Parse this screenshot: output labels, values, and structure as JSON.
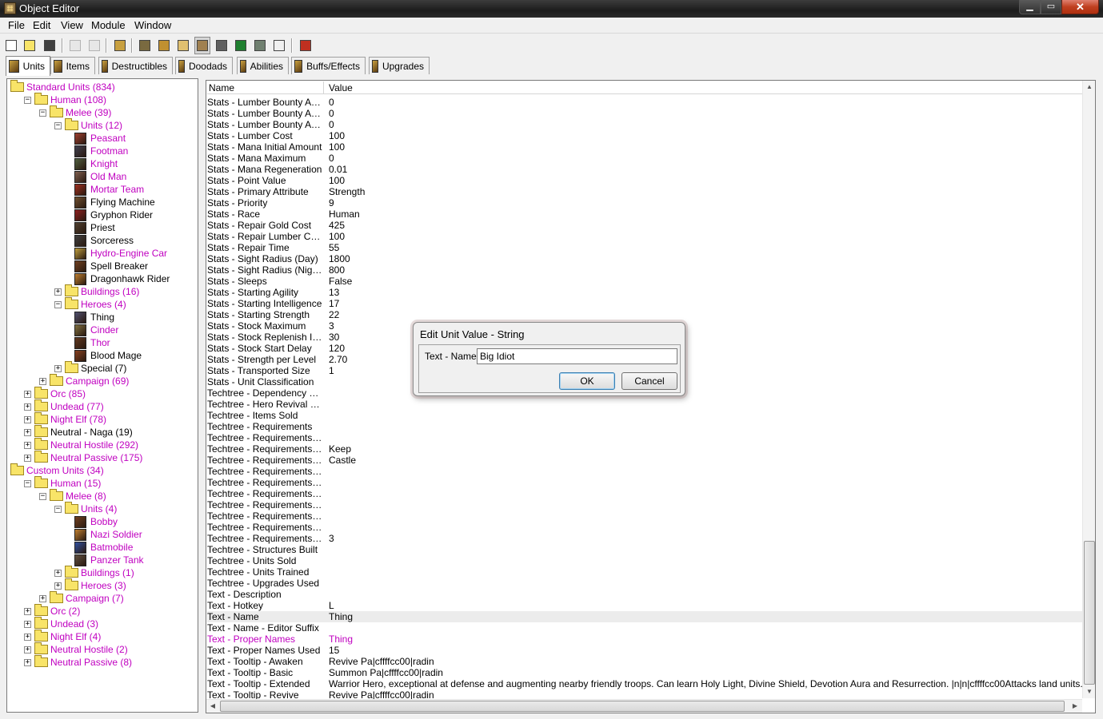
{
  "window": {
    "title": "Object Editor"
  },
  "menu": [
    "File",
    "Edit",
    "View",
    "Module",
    "Window"
  ],
  "tabs": [
    {
      "label": "Units",
      "icon": "units-icon",
      "active": true
    },
    {
      "label": "Items",
      "icon": "items-icon"
    },
    {
      "label": "Destructibles",
      "icon": "destructibles-icon"
    },
    {
      "label": "Doodads",
      "icon": "doodads-icon"
    },
    {
      "label": "Abilities",
      "icon": "abilities-icon"
    },
    {
      "label": "Buffs/Effects",
      "icon": "buffs-icon"
    },
    {
      "label": "Upgrades",
      "icon": "upgrades-icon"
    }
  ],
  "tree": [
    {
      "label": "Standard Units (834)",
      "custom": true
    },
    {
      "label": "Human (108)",
      "custom": true
    },
    {
      "label": "Melee (39)",
      "custom": true
    },
    {
      "label": "Units (12)",
      "custom": true
    },
    {
      "label": "Peasant",
      "custom": true
    },
    {
      "label": "Footman",
      "custom": true
    },
    {
      "label": "Knight",
      "custom": true
    },
    {
      "label": "Old Man",
      "custom": true
    },
    {
      "label": "Mortar Team",
      "custom": true
    },
    {
      "label": "Flying Machine",
      "custom": false
    },
    {
      "label": "Gryphon Rider",
      "custom": false
    },
    {
      "label": "Priest",
      "custom": false
    },
    {
      "label": "Sorceress",
      "custom": false
    },
    {
      "label": "Hydro-Engine Car",
      "custom": true
    },
    {
      "label": "Spell Breaker",
      "custom": false
    },
    {
      "label": "Dragonhawk Rider",
      "custom": false
    },
    {
      "label": "Buildings (16)",
      "custom": true
    },
    {
      "label": "Heroes (4)",
      "custom": true
    },
    {
      "label": "Thing",
      "custom": false
    },
    {
      "label": "Cinder",
      "custom": true
    },
    {
      "label": "Thor",
      "custom": true
    },
    {
      "label": "Blood Mage",
      "custom": false
    },
    {
      "label": "Special (7)",
      "custom": false
    },
    {
      "label": "Campaign (69)",
      "custom": true
    },
    {
      "label": "Orc (85)",
      "custom": true
    },
    {
      "label": "Undead (77)",
      "custom": true
    },
    {
      "label": "Night Elf (78)",
      "custom": true
    },
    {
      "label": "Neutral - Naga (19)",
      "custom": false
    },
    {
      "label": "Neutral Hostile (292)",
      "custom": true
    },
    {
      "label": "Neutral Passive (175)",
      "custom": true
    },
    {
      "label": "Custom Units (34)",
      "custom": true
    },
    {
      "label": "Human (15)",
      "custom": true
    },
    {
      "label": "Melee (8)",
      "custom": true
    },
    {
      "label": "Units (4)",
      "custom": true
    },
    {
      "label": "Bobby",
      "custom": true
    },
    {
      "label": "Nazi Soldier",
      "custom": true
    },
    {
      "label": "Batmobile",
      "custom": true
    },
    {
      "label": "Panzer Tank",
      "custom": true
    },
    {
      "label": "Buildings (1)",
      "custom": true
    },
    {
      "label": "Heroes (3)",
      "custom": true
    },
    {
      "label": "Campaign (7)",
      "custom": true
    },
    {
      "label": "Orc (2)",
      "custom": true
    },
    {
      "label": "Undead (3)",
      "custom": true
    },
    {
      "label": "Night Elf (4)",
      "custom": true
    },
    {
      "label": "Neutral Hostile (2)",
      "custom": true
    },
    {
      "label": "Neutral Passive (8)",
      "custom": true
    }
  ],
  "grid": {
    "headers": {
      "name": "Name",
      "value": "Value"
    },
    "rows": [
      {
        "name": "Stats - Lumber Bounty Awar...",
        "value": "0"
      },
      {
        "name": "Stats - Lumber Bounty Awar...",
        "value": "0"
      },
      {
        "name": "Stats - Lumber Bounty Awar...",
        "value": "0"
      },
      {
        "name": "Stats - Lumber Cost",
        "value": "100"
      },
      {
        "name": "Stats - Mana Initial Amount",
        "value": "100"
      },
      {
        "name": "Stats - Mana Maximum",
        "value": "0"
      },
      {
        "name": "Stats - Mana Regeneration",
        "value": "0.01"
      },
      {
        "name": "Stats - Point Value",
        "value": "100"
      },
      {
        "name": "Stats - Primary Attribute",
        "value": "Strength"
      },
      {
        "name": "Stats - Priority",
        "value": "9"
      },
      {
        "name": "Stats - Race",
        "value": "Human"
      },
      {
        "name": "Stats - Repair Gold Cost",
        "value": "425"
      },
      {
        "name": "Stats - Repair Lumber Cost",
        "value": "100"
      },
      {
        "name": "Stats - Repair Time",
        "value": "55"
      },
      {
        "name": "Stats - Sight Radius (Day)",
        "value": "1800"
      },
      {
        "name": "Stats - Sight Radius (Night)",
        "value": "800"
      },
      {
        "name": "Stats - Sleeps",
        "value": "False"
      },
      {
        "name": "Stats - Starting Agility",
        "value": "13"
      },
      {
        "name": "Stats - Starting Intelligence",
        "value": "17"
      },
      {
        "name": "Stats - Starting Strength",
        "value": "22"
      },
      {
        "name": "Stats - Stock Maximum",
        "value": "3"
      },
      {
        "name": "Stats - Stock Replenish Inter...",
        "value": "30"
      },
      {
        "name": "Stats - Stock Start Delay",
        "value": "120"
      },
      {
        "name": "Stats - Strength per Level",
        "value": "2.70"
      },
      {
        "name": "Stats - Transported Size",
        "value": "1"
      },
      {
        "name": "Stats - Unit Classification",
        "value": ""
      },
      {
        "name": "Techtree - Dependency Equ...",
        "value": ""
      },
      {
        "name": "Techtree - Hero Revival Loc...",
        "value": ""
      },
      {
        "name": "Techtree - Items Sold",
        "value": ""
      },
      {
        "name": "Techtree - Requirements",
        "value": ""
      },
      {
        "name": "Techtree - Requirements - L...",
        "value": ""
      },
      {
        "name": "Techtree - Requirements - Ti...",
        "value": "Keep"
      },
      {
        "name": "Techtree - Requirements - Ti...",
        "value": "Castle"
      },
      {
        "name": "Techtree - Requirements - Ti...",
        "value": ""
      },
      {
        "name": "Techtree - Requirements - Ti...",
        "value": ""
      },
      {
        "name": "Techtree - Requirements - Ti...",
        "value": ""
      },
      {
        "name": "Techtree - Requirements - Ti...",
        "value": ""
      },
      {
        "name": "Techtree - Requirements - Ti...",
        "value": ""
      },
      {
        "name": "Techtree - Requirements - Ti...",
        "value": ""
      },
      {
        "name": "Techtree - Requirements - Ti...",
        "value": "3"
      },
      {
        "name": "Techtree - Structures Built",
        "value": ""
      },
      {
        "name": "Techtree - Units Sold",
        "value": ""
      },
      {
        "name": "Techtree - Units Trained",
        "value": ""
      },
      {
        "name": "Techtree - Upgrades Used",
        "value": ""
      },
      {
        "name": "Text - Description",
        "value": ""
      },
      {
        "name": "Text - Hotkey",
        "value": "L"
      },
      {
        "name": "Text - Name",
        "value": "Thing",
        "selected": true
      },
      {
        "name": "Text - Name - Editor Suffix",
        "value": ""
      },
      {
        "name": "Text - Proper Names",
        "value": "Thing",
        "modified": true
      },
      {
        "name": "Text - Proper Names Used",
        "value": "15"
      },
      {
        "name": "Text - Tooltip - Awaken",
        "value": "Revive Pa|cffffcc00|radin"
      },
      {
        "name": "Text - Tooltip - Basic",
        "value": "Summon Pa|cffffcc00|radin"
      },
      {
        "name": "Text - Tooltip - Extended",
        "value": "Warrior Hero, exceptional at defense and augmenting nearby friendly troops. Can learn Holy Light, Divine Shield, Devotion Aura and Resurrection. |n|n|cffffcc00Attacks land units.|r"
      },
      {
        "name": "Text - Tooltip - Revive",
        "value": "Revive Pa|cffffcc00|radin"
      }
    ]
  },
  "dialog": {
    "title": "Edit Unit Value - String",
    "label": "Text - Name:",
    "value": "Big Idiot",
    "ok": "OK",
    "cancel": "Cancel"
  },
  "colors": {
    "modified": "#c000c0",
    "selected_row": "#ececec",
    "close_button": "#c04020"
  }
}
